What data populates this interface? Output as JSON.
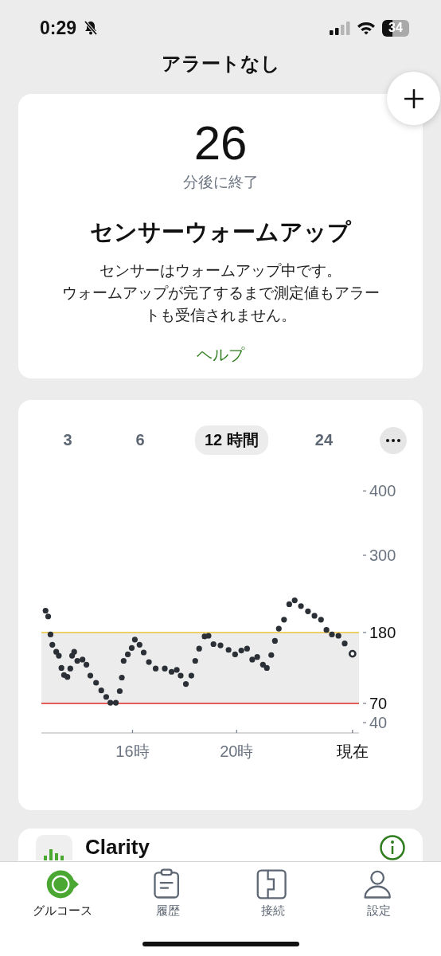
{
  "status_bar": {
    "time": "0:29",
    "battery": "34"
  },
  "header": {
    "title": "アラートなし"
  },
  "warmup": {
    "minutes": "26",
    "minutes_label": "分後に終了",
    "title": "センサーウォームアップ",
    "message_lines": [
      "センサーはウォームアップ中です。",
      "ウォームアップが完了するまで測定値もアラートも受信されません。"
    ],
    "help_link": "ヘルプ"
  },
  "chart_card": {
    "ranges": [
      {
        "label": "3",
        "selected": false
      },
      {
        "label": "6",
        "selected": false
      },
      {
        "label": "12 時間",
        "selected": true
      },
      {
        "label": "24",
        "selected": false
      }
    ],
    "chart_data": {
      "type": "scatter",
      "xlim": [
        12.5,
        24.7
      ],
      "ylim": [
        24,
        400
      ],
      "xticks": [
        {
          "value": 16,
          "label": "16時"
        },
        {
          "value": 20,
          "label": "20時"
        },
        {
          "value": 24.45,
          "label": "現在"
        }
      ],
      "yticks": [
        {
          "value": 400,
          "label": "400"
        },
        {
          "value": 300,
          "label": "300"
        },
        {
          "value": 180,
          "label": "180"
        },
        {
          "value": 70,
          "label": "70"
        },
        {
          "value": 40,
          "label": "40"
        }
      ],
      "bands": [
        {
          "axis": "y",
          "from": 70,
          "to": 180,
          "color": "#ececec"
        }
      ],
      "ref_lines": [
        {
          "axis": "y",
          "value": 180,
          "color": "#e8c33a"
        },
        {
          "axis": "y",
          "value": 70,
          "color": "#e0443e"
        }
      ],
      "x": [
        12.66,
        12.76,
        12.85,
        12.92,
        13.07,
        13.17,
        13.27,
        13.37,
        13.5,
        13.61,
        13.68,
        13.76,
        13.88,
        14.08,
        14.23,
        14.38,
        14.6,
        14.8,
        14.99,
        15.15,
        15.36,
        15.51,
        15.59,
        15.66,
        15.82,
        15.97,
        16.09,
        16.27,
        16.43,
        16.63,
        16.89,
        17.24,
        17.5,
        17.7,
        17.85,
        18.05,
        18.26,
        18.41,
        18.56,
        18.77,
        18.92,
        19.11,
        19.38,
        19.69,
        19.94,
        20.18,
        20.4,
        20.6,
        20.79,
        21.01,
        21.16,
        21.33,
        21.47,
        21.62,
        21.82,
        22.02,
        22.23,
        22.47,
        22.74,
        22.99,
        23.24,
        23.45,
        23.66,
        23.91,
        24.15,
        24.45
      ],
      "series": [
        {
          "color": "#2b2f36",
          "values": [
            214,
            205,
            177,
            161,
            150,
            144,
            125,
            114,
            111,
            124,
            144,
            150,
            136,
            138,
            130,
            113,
            102,
            90,
            80,
            71,
            71,
            89,
            110,
            136,
            146,
            156,
            169,
            161,
            149,
            134,
            124,
            124,
            119,
            122,
            113,
            100,
            113,
            136,
            155,
            174,
            175,
            162,
            160,
            153,
            146,
            152,
            155,
            138,
            142,
            130,
            125,
            145,
            167,
            186,
            200,
            224,
            230,
            221,
            213,
            206,
            200,
            184,
            177,
            175,
            163,
            147
          ]
        }
      ]
    }
  },
  "clarity_card": {
    "title": "Clarity"
  },
  "tab_bar": {
    "tabs": [
      {
        "kind": "glucose",
        "label": "グルコース",
        "selected": true
      },
      {
        "kind": "history",
        "label": "履歴",
        "selected": false
      },
      {
        "kind": "connection",
        "label": "接続",
        "selected": false
      },
      {
        "kind": "settings",
        "label": "設定",
        "selected": false
      }
    ]
  }
}
